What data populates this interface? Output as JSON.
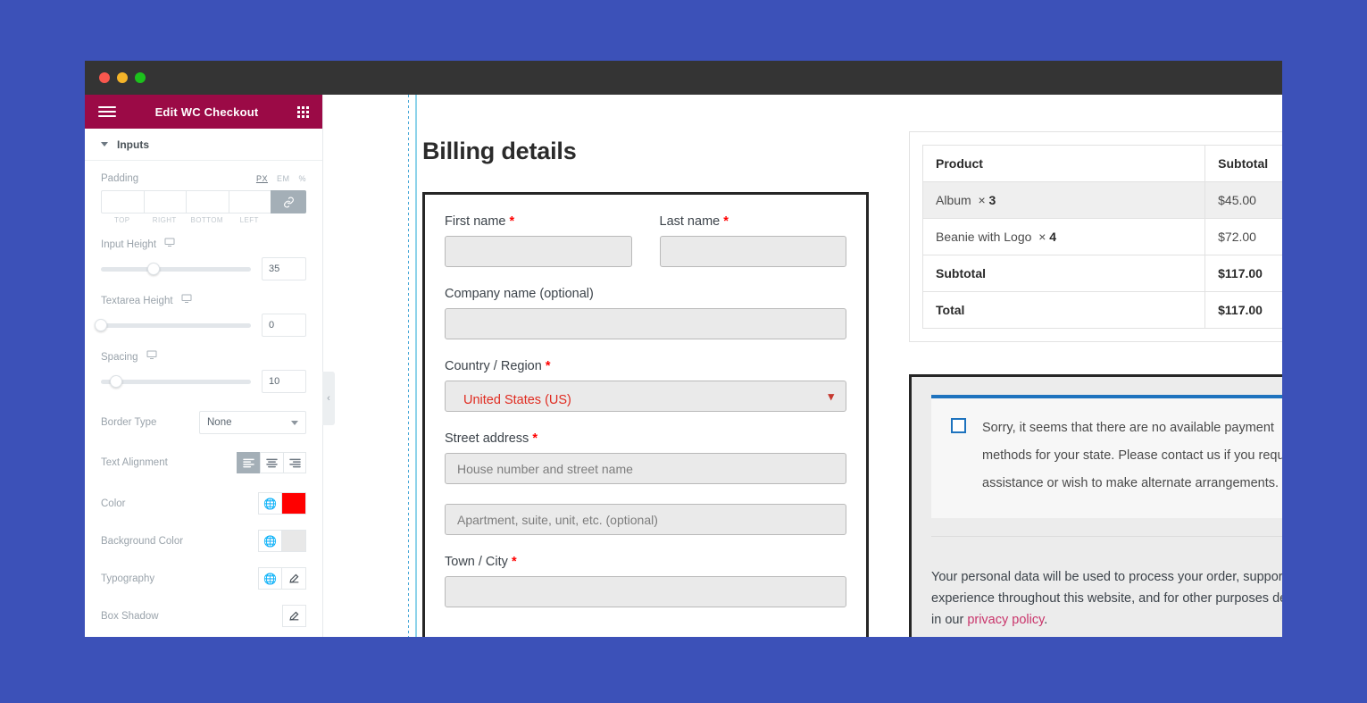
{
  "theme": {
    "page_background": "#3c51b8",
    "panel_header_color": "#9b0a46",
    "accent_red": "#ff0000",
    "notice_blue": "#1e73be",
    "link_pink": "#c9356b"
  },
  "window": {
    "titlebar_buttons": [
      "close-red",
      "minimize-yellow",
      "maximize-green"
    ]
  },
  "panel": {
    "menu_icon": "hamburger-icon",
    "title": "Edit WC Checkout",
    "apps_icon": "grid-apps-icon",
    "section": {
      "label": "Inputs",
      "caret": "chevron-down-icon"
    },
    "controls": {
      "padding": {
        "label": "Padding",
        "units": [
          "PX",
          "EM",
          "%"
        ],
        "active_unit": "PX",
        "values": [
          "",
          "",
          "",
          ""
        ],
        "sides": [
          "TOP",
          "RIGHT",
          "BOTTOM",
          "LEFT"
        ],
        "link_icon": "link-icon"
      },
      "input_height": {
        "label": "Input Height",
        "device_icon": "desktop-icon",
        "value": "35",
        "slider_percent": 35
      },
      "textarea_height": {
        "label": "Textarea Height",
        "device_icon": "desktop-icon",
        "value": "0",
        "slider_percent": 0
      },
      "spacing": {
        "label": "Spacing",
        "device_icon": "desktop-icon",
        "value": "10",
        "slider_percent": 10
      },
      "border_type": {
        "label": "Border Type",
        "value": "None"
      },
      "text_alignment": {
        "label": "Text Alignment",
        "options": [
          "left",
          "center",
          "right"
        ],
        "selected": "left"
      },
      "color": {
        "label": "Color",
        "globe_icon": "globe-icon",
        "swatch": "#ff0000"
      },
      "background_color": {
        "label": "Background Color",
        "globe_icon": "globe-icon",
        "swatch": "#e8e8e8"
      },
      "typography": {
        "label": "Typography",
        "globe_icon": "globe-icon",
        "edit_icon": "pencil-icon"
      },
      "box_shadow": {
        "label": "Box Shadow",
        "edit_icon": "pencil-icon"
      }
    },
    "collapse_icon": "chevron-left-icon"
  },
  "billing": {
    "title": "Billing details",
    "fields": {
      "first_name": {
        "label": "First name",
        "required": true,
        "value": ""
      },
      "last_name": {
        "label": "Last name",
        "required": true,
        "value": ""
      },
      "company_name": {
        "label": "Company name (optional)",
        "required": false,
        "value": ""
      },
      "country": {
        "label": "Country / Region",
        "required": true,
        "value": "United States (US)",
        "chevron": "chevron-down-icon"
      },
      "street_address": {
        "label": "Street address",
        "required": true,
        "placeholder": "House number and street name"
      },
      "address_2": {
        "placeholder": "Apartment, suite, unit, etc. (optional)"
      },
      "town_city": {
        "label": "Town / City",
        "required": true,
        "value": ""
      }
    }
  },
  "order": {
    "headers": [
      "Product",
      "Subtotal"
    ],
    "rows": [
      {
        "product": "Album",
        "qty": "3",
        "subtotal": "$45.00",
        "bold": false
      },
      {
        "product": "Beanie with Logo",
        "qty": "4",
        "subtotal": "$72.00",
        "bold": false
      }
    ],
    "totals": [
      {
        "label": "Subtotal",
        "value": "$117.00"
      },
      {
        "label": "Total",
        "value": "$117.00"
      }
    ],
    "qty_separator": "×"
  },
  "payment": {
    "checkbox_icon": "checkbox-icon",
    "notice": "Sorry, it seems that there are no available payment methods for your state. Please contact us if you require assistance or wish to make alternate arrangements.",
    "privacy_text_before": "Your personal data will be used to process your order, support your experience throughout this website, and for other purposes described in our ",
    "privacy_link": "privacy policy",
    "privacy_text_after": "."
  }
}
